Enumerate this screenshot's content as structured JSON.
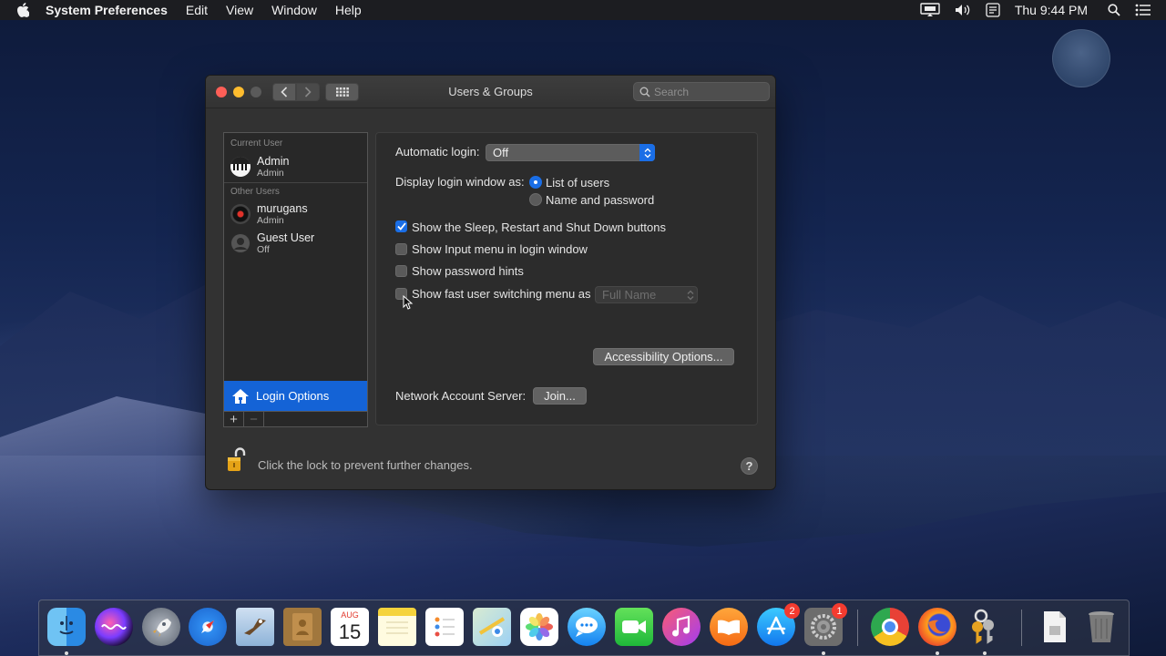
{
  "menubar": {
    "app_name": "System Preferences",
    "menus": [
      "Edit",
      "View",
      "Window",
      "Help"
    ],
    "clock": "Thu 9:44 PM"
  },
  "window": {
    "title": "Users & Groups",
    "search_placeholder": "Search"
  },
  "sidebar": {
    "current_user_header": "Current User",
    "current_user": {
      "name": "Admin",
      "role": "Admin"
    },
    "other_users_header": "Other Users",
    "other_users": [
      {
        "name": "murugans",
        "role": "Admin"
      },
      {
        "name": "Guest User",
        "role": "Off"
      }
    ],
    "login_options_label": "Login Options",
    "add_symbol": "+",
    "remove_symbol": "−"
  },
  "login_options": {
    "automatic_login_label": "Automatic login:",
    "automatic_login_value": "Off",
    "display_login_label": "Display login window as:",
    "radio_list_of_users": "List of users",
    "radio_name_and_password": "Name and password",
    "selected_display": "List of users",
    "checkboxes": [
      {
        "label": "Show the Sleep, Restart and Shut Down buttons",
        "checked": true
      },
      {
        "label": "Show Input menu in login window",
        "checked": false
      },
      {
        "label": "Show password hints",
        "checked": false
      },
      {
        "label": "Show fast user switching menu as",
        "checked": false
      }
    ],
    "fast_user_switching_value": "Full Name",
    "accessibility_button": "Accessibility Options...",
    "network_account_label": "Network Account Server:",
    "join_button": "Join..."
  },
  "footer": {
    "lock_text": "Click the lock to prevent further changes.",
    "help_symbol": "?"
  },
  "dock": {
    "calendar_month": "AUG",
    "calendar_day": "15",
    "app_store_badge": "2",
    "system_prefs_badge": "1"
  },
  "colors": {
    "accent": "#1a6ee6",
    "selection": "#1463d6",
    "window_bg": "#323232",
    "badge": "#f43b2f"
  }
}
